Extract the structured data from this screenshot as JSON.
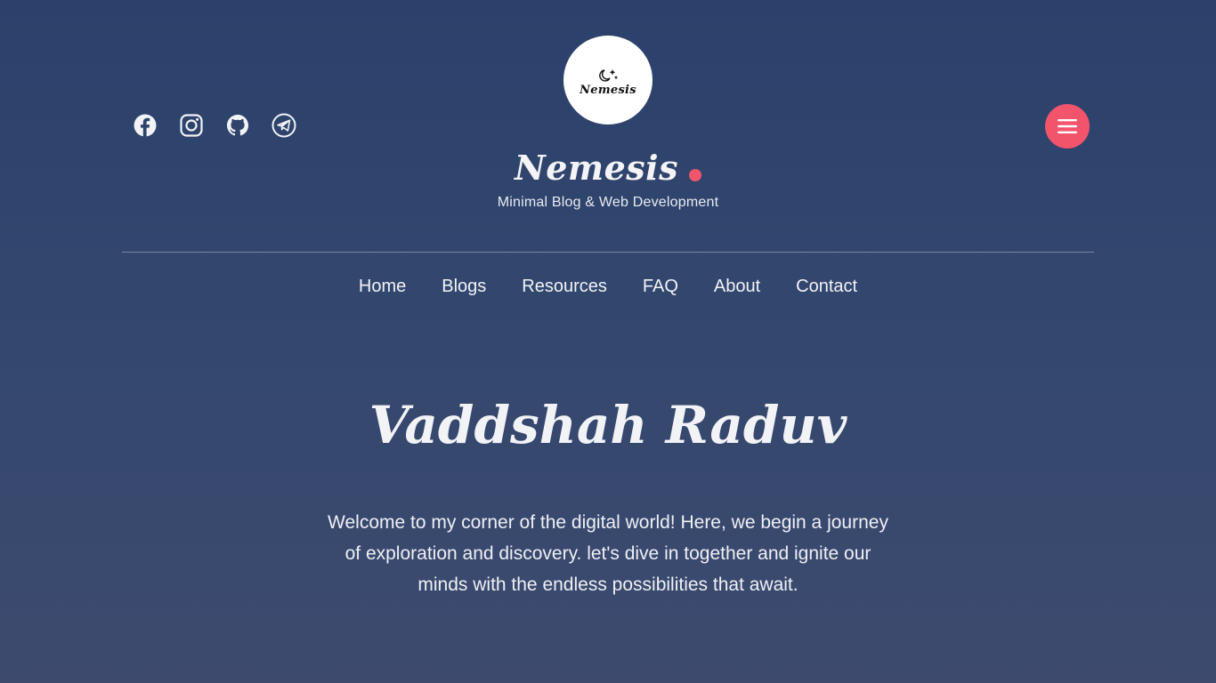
{
  "logo": {
    "badge_text": "Nemesis",
    "icon": "moon-stars-icon"
  },
  "socials": [
    {
      "name": "facebook",
      "icon": "facebook-icon"
    },
    {
      "name": "instagram",
      "icon": "instagram-icon"
    },
    {
      "name": "github",
      "icon": "github-icon"
    },
    {
      "name": "telegram",
      "icon": "telegram-icon"
    }
  ],
  "menu": {
    "icon": "hamburger-icon",
    "color": "#f2546b"
  },
  "site": {
    "title": "Nemesis",
    "tagline": "Minimal Blog & Web Development",
    "accent": "#f2546b"
  },
  "nav": {
    "items": [
      "Home",
      "Blogs",
      "Resources",
      "FAQ",
      "About",
      "Contact"
    ]
  },
  "hero": {
    "title": "Vaddshah Raduv",
    "text": "Welcome to my corner of the digital world! Here, we begin a journey of exploration and discovery. let's dive in together and ignite our minds with the endless possibilities that await."
  }
}
